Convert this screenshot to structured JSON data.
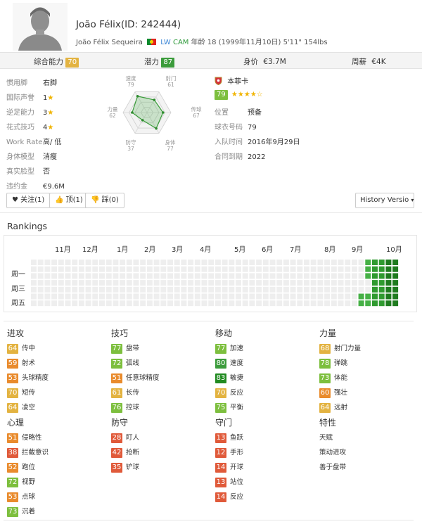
{
  "player": {
    "name": "João Félix(ID: 242444)",
    "full_name": "João Félix Sequeira",
    "position_main": "LW",
    "position_alt": "CAM",
    "details": "年龄 18 (1999年11月10日) 5'11\" 154lbs"
  },
  "stats_bar": {
    "overall_label": "综合能力",
    "overall_value": "70",
    "potential_label": "潜力",
    "potential_value": "87",
    "value_label": "身价",
    "value_amount": "€3.7M",
    "wage_label": "周薪",
    "wage_amount": "€4K"
  },
  "info_left": [
    {
      "label": "惯用脚",
      "value": "右脚"
    },
    {
      "label": "国际声誉",
      "value": "1★"
    },
    {
      "label": "逆足能力",
      "value": "3★"
    },
    {
      "label": "花式技巧",
      "value": "4★"
    },
    {
      "label": "Work Rate",
      "value": "高/ 低"
    },
    {
      "label": "身体模型",
      "value": "消瘦"
    },
    {
      "label": "真实脸型",
      "value": "否"
    },
    {
      "label": "违约金",
      "value": "€9.6M"
    }
  ],
  "radar": {
    "labels": [
      {
        "name": "射门",
        "value": "61"
      },
      {
        "name": "传球",
        "value": "67"
      },
      {
        "name": "身体",
        "value": "77"
      },
      {
        "name": "防守",
        "value": "37"
      },
      {
        "name": "力量",
        "value": "62"
      },
      {
        "name": "速度",
        "value": "79"
      }
    ]
  },
  "club": {
    "name": "本菲卡",
    "rating": "79",
    "stars": "★★★★☆",
    "rows": [
      {
        "label": "位置",
        "value": "预备"
      },
      {
        "label": "球衣号码",
        "value": "79"
      },
      {
        "label": "入队时间",
        "value": "2016年9月29日"
      },
      {
        "label": "合同到期",
        "value": "2022"
      }
    ]
  },
  "buttons": {
    "follow": "关注(1)",
    "like": "顶(1)",
    "dislike": "踩(0)",
    "history": "History Versio"
  },
  "rankings": {
    "title": "Rankings",
    "months": [
      "11月",
      "12月",
      "1月",
      "2月",
      "3月",
      "4月",
      "5月",
      "6月",
      "7月",
      "8月",
      "9月",
      "10月"
    ],
    "weekdays": [
      "周一",
      "周三",
      "周五"
    ]
  },
  "categories": [
    {
      "title": "进攻",
      "items": [
        {
          "value": "64",
          "label": "传中",
          "color": "yellow"
        },
        {
          "value": "59",
          "label": "射术",
          "color": "orange"
        },
        {
          "value": "53",
          "label": "头球精度",
          "color": "orange"
        },
        {
          "value": "70",
          "label": "短传",
          "color": "yellow"
        },
        {
          "value": "64",
          "label": "凌空",
          "color": "yellow"
        }
      ]
    },
    {
      "title": "技巧",
      "items": [
        {
          "value": "77",
          "label": "盘带",
          "color": "lgreen"
        },
        {
          "value": "72",
          "label": "弧线",
          "color": "lgreen"
        },
        {
          "value": "51",
          "label": "任意球精度",
          "color": "orange"
        },
        {
          "value": "61",
          "label": "长传",
          "color": "yellow"
        },
        {
          "value": "76",
          "label": "控球",
          "color": "lgreen"
        }
      ]
    },
    {
      "title": "移动",
      "items": [
        {
          "value": "77",
          "label": "加速",
          "color": "lgreen"
        },
        {
          "value": "80",
          "label": "速度",
          "color": "green"
        },
        {
          "value": "83",
          "label": "敏捷",
          "color": "dgreen"
        },
        {
          "value": "70",
          "label": "反应",
          "color": "yellow"
        },
        {
          "value": "75",
          "label": "平衡",
          "color": "lgreen"
        }
      ]
    },
    {
      "title": "力量",
      "items": [
        {
          "value": "68",
          "label": "射门力量",
          "color": "yellow"
        },
        {
          "value": "78",
          "label": "弹跳",
          "color": "lgreen"
        },
        {
          "value": "73",
          "label": "体能",
          "color": "lgreen"
        },
        {
          "value": "60",
          "label": "强壮",
          "color": "orange"
        },
        {
          "value": "64",
          "label": "远射",
          "color": "yellow"
        }
      ]
    },
    {
      "title": "心理",
      "items": [
        {
          "value": "51",
          "label": "侵略性",
          "color": "orange"
        },
        {
          "value": "38",
          "label": "拦截意识",
          "color": "red"
        },
        {
          "value": "52",
          "label": "跑位",
          "color": "orange"
        },
        {
          "value": "72",
          "label": "视野",
          "color": "lgreen"
        },
        {
          "value": "53",
          "label": "点球",
          "color": "orange"
        },
        {
          "value": "73",
          "label": "沉着",
          "color": "lgreen"
        }
      ]
    },
    {
      "title": "防守",
      "items": [
        {
          "value": "28",
          "label": "盯人",
          "color": "red"
        },
        {
          "value": "42",
          "label": "抢断",
          "color": "red"
        },
        {
          "value": "35",
          "label": "铲球",
          "color": "red"
        }
      ]
    },
    {
      "title": "守门",
      "items": [
        {
          "value": "13",
          "label": "鱼跃",
          "color": "red"
        },
        {
          "value": "12",
          "label": "手形",
          "color": "red"
        },
        {
          "value": "14",
          "label": "开球",
          "color": "red"
        },
        {
          "value": "13",
          "label": "站位",
          "color": "red"
        },
        {
          "value": "14",
          "label": "反应",
          "color": "red"
        }
      ]
    },
    {
      "title": "特性",
      "traits": [
        "天赋",
        "策动进攻",
        "善于盘带"
      ]
    }
  ],
  "colors": {
    "yellow": "#e3b341",
    "lgreen": "#7dbf3e",
    "green": "#3c9c3c",
    "dgreen": "#228b22",
    "orange": "#e98b2d",
    "red": "#e05a3a"
  }
}
